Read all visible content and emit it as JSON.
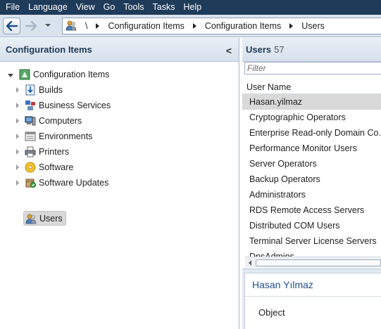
{
  "menu": [
    "File",
    "Language",
    "View",
    "Go",
    "Tools",
    "Tasks",
    "Help"
  ],
  "address": {
    "root": "\\",
    "crumbs": [
      "Configuration Items",
      "Configuration Items",
      "Users"
    ]
  },
  "left_pane": {
    "title": "Configuration Items",
    "collapse_glyph": "<",
    "root": {
      "label": "Configuration Items",
      "icon": "configuration-items-icon"
    },
    "items": [
      {
        "label": "Builds",
        "icon": "builds-icon"
      },
      {
        "label": "Business Services",
        "icon": "business-services-icon"
      },
      {
        "label": "Computers",
        "icon": "computers-icon"
      },
      {
        "label": "Environments",
        "icon": "environments-icon"
      },
      {
        "label": "Printers",
        "icon": "printers-icon"
      },
      {
        "label": "Software",
        "icon": "software-icon"
      },
      {
        "label": "Software Updates",
        "icon": "software-updates-icon"
      },
      {
        "label": "Users",
        "icon": "users-icon",
        "selected": true
      }
    ]
  },
  "right_pane": {
    "title": "Users",
    "count": "57",
    "filter_placeholder": "Filter",
    "column_header": "User Name",
    "rows": [
      "Hasan.yilmaz",
      "Cryptographic Operators",
      "Enterprise Read-only Domain Co...",
      "Performance Monitor Users",
      "Server Operators",
      "Backup Operators",
      "Administrators",
      "RDS Remote Access Servers",
      "Distributed COM Users",
      "Terminal Server License Servers",
      "DnsAdmins"
    ],
    "selected_index": 0
  },
  "details": {
    "title": "Hasan Yılmaz",
    "subtitle": "Object"
  },
  "colors": {
    "menubar": "#1f3b5a",
    "pane_header": "#dfe7f0",
    "selection": "#d9d9d9",
    "details_title": "#1f4e8c"
  }
}
